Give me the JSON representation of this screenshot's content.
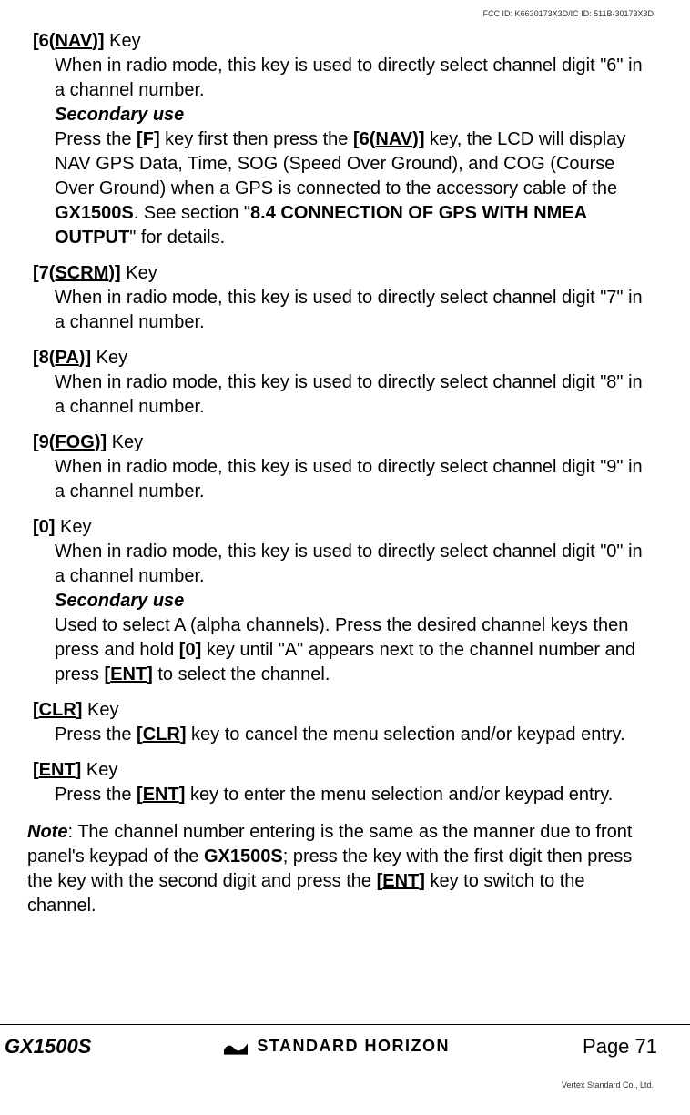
{
  "header_small": "FCC ID: K6630173X3D/IC ID: 511B-30173X3D",
  "footer_small": "Vertex Standard Co., Ltd.",
  "keys": [
    {
      "title_parts": [
        "[",
        "6",
        "(",
        "NAV",
        ")",
        "] Key"
      ],
      "body_runs": [
        {
          "t": "When in radio mode, this key is used to directly select channel digit \"6\" in a channel number."
        }
      ],
      "secondary_label": "Secondary use",
      "secondary_runs": [
        {
          "t": "Press the "
        },
        {
          "t": "[",
          "b": true
        },
        {
          "t": "F",
          "b": true
        },
        {
          "t": "]",
          "b": true
        },
        {
          "t": " key first then press the "
        },
        {
          "t": "[",
          "b": true
        },
        {
          "t": "6",
          "b": true
        },
        {
          "t": "(",
          "b": true
        },
        {
          "t": "NAV",
          "bu": true
        },
        {
          "t": ")",
          "b": true
        },
        {
          "t": "]",
          "b": true
        },
        {
          "t": " key, the LCD will display NAV GPS Data, Time, SOG (Speed Over Ground), and COG (Course Over Ground) when a GPS is connected to the accessory cable of the "
        },
        {
          "t": "GX1500S",
          "b": true
        },
        {
          "t": ". See section \""
        },
        {
          "t": "8.4 CONNECTION OF GPS WITH NMEA OUTPUT",
          "b": true
        },
        {
          "t": "\" for details."
        }
      ]
    },
    {
      "title_parts": [
        "[",
        "7",
        "(",
        "SCRM",
        ")",
        "] Key"
      ],
      "body_runs": [
        {
          "t": "When in radio mode, this key is used to directly select channel digit \"7\" in a channel number."
        }
      ]
    },
    {
      "title_parts": [
        "[",
        "8",
        "(",
        "PA",
        ")",
        "] Key"
      ],
      "body_runs": [
        {
          "t": "When in radio mode, this key is used to directly select channel digit \"8\" in a channel number."
        }
      ]
    },
    {
      "title_parts": [
        "[",
        "9",
        "(",
        "FOG",
        ")",
        "] Key"
      ],
      "body_runs": [
        {
          "t": "When in radio mode, this key is used to directly select channel digit \"9\" in a channel number."
        }
      ]
    },
    {
      "title_parts": [
        "[",
        "0",
        "",
        "",
        "",
        "] Key"
      ],
      "body_runs": [
        {
          "t": "When in radio mode, this key is used to directly select channel digit \"0\" in a channel number."
        }
      ],
      "secondary_label": "Secondary use",
      "secondary_runs": [
        {
          "t": "Used to select A (alpha channels). Press the desired channel keys then press and hold "
        },
        {
          "t": "[",
          "b": true
        },
        {
          "t": "0",
          "b": true
        },
        {
          "t": "]",
          "b": true
        },
        {
          "t": " key until \"A\" appears next to the channel number and press "
        },
        {
          "t": "[",
          "b": true
        },
        {
          "t": "ENT",
          "bu": true
        },
        {
          "t": "]",
          "b": true
        },
        {
          "t": " to select the channel."
        }
      ]
    },
    {
      "title_parts": [
        "[",
        "CLR",
        "",
        "",
        "",
        "] Key"
      ],
      "title_underline_idx": 1,
      "body_runs": [
        {
          "t": "Press the "
        },
        {
          "t": "[",
          "b": true
        },
        {
          "t": "CLR",
          "bu": true
        },
        {
          "t": "]",
          "b": true
        },
        {
          "t": " key to cancel the menu selection and/or keypad entry."
        }
      ]
    },
    {
      "title_parts": [
        "[",
        "ENT",
        "",
        "",
        "",
        "] Key"
      ],
      "title_underline_idx": 1,
      "body_runs": [
        {
          "t": "Press the "
        },
        {
          "t": "[",
          "b": true
        },
        {
          "t": "ENT",
          "bu": true
        },
        {
          "t": "]",
          "b": true
        },
        {
          "t": " key to enter the menu selection and/or keypad entry."
        }
      ]
    }
  ],
  "note_runs": [
    {
      "t": "Note",
      "bi": true
    },
    {
      "t": ": The channel number entering is the same as the manner due to front panel's keypad of the "
    },
    {
      "t": "GX1500S",
      "b": true
    },
    {
      "t": "; press the key with the first digit then press the key with the second digit and press the "
    },
    {
      "t": "[",
      "b": true
    },
    {
      "t": "ENT",
      "bu": true
    },
    {
      "t": "]",
      "b": true
    },
    {
      "t": " key to switch to the channel."
    }
  ],
  "footer": {
    "model": "GX1500S",
    "brand": "STANDARD HORIZON",
    "page": "Page 71"
  }
}
